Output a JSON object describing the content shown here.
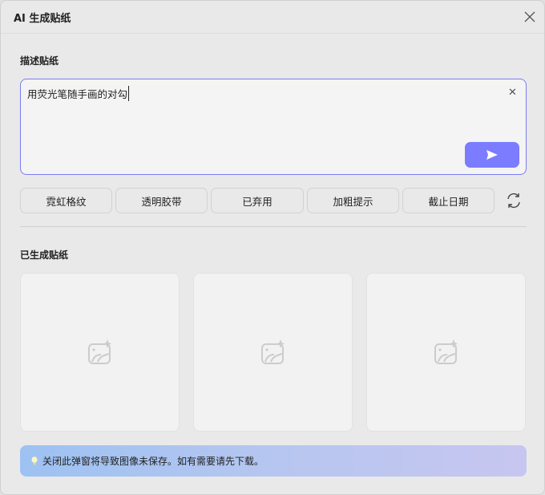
{
  "dialog": {
    "title": "AI 生成贴纸"
  },
  "describe": {
    "label": "描述贴纸",
    "value": "用荧光笔随手画的对勾"
  },
  "chips": [
    "霓虹格纹",
    "透明胶带",
    "已弃用",
    "加粗提示",
    "截止日期"
  ],
  "generated": {
    "label": "已生成贴纸"
  },
  "banner": {
    "text": "关闭此弹窗将导致图像未保存。如有需要请先下载。"
  },
  "colors": {
    "accent": "#7b7cff"
  }
}
